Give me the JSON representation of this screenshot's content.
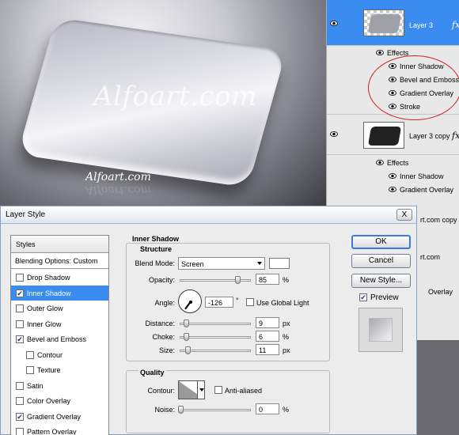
{
  "canvas": {
    "watermark": "Alfoart.com",
    "small_watermark": "Alfoart.com"
  },
  "layers_panel": {
    "layers": [
      {
        "name": "Layer 3",
        "selected": true,
        "fx_symbol": "fx",
        "effects_label": "Effects",
        "effects": [
          "Inner Shadow",
          "Bevel and Emboss",
          "Gradient Overlay",
          "Stroke"
        ]
      },
      {
        "name": "Layer 3 copy",
        "selected": false,
        "fx_symbol": "fx",
        "effects_label": "Effects",
        "effects": [
          "Inner Shadow",
          "Gradient Overlay"
        ]
      }
    ],
    "peek_texts": [
      "rt.com copy",
      "rt.com",
      "Overlay"
    ],
    "highlight_color": "#d02020"
  },
  "dialog": {
    "title": "Layer Style",
    "close_symbol": "X",
    "styles_header": "Styles",
    "blending_options": "Blending Options: Custom",
    "style_items": [
      {
        "label": "Drop Shadow",
        "checked": false,
        "active": false,
        "sub": false
      },
      {
        "label": "Inner Shadow",
        "checked": true,
        "active": true,
        "sub": false
      },
      {
        "label": "Outer Glow",
        "checked": false,
        "active": false,
        "sub": false
      },
      {
        "label": "Inner Glow",
        "checked": false,
        "active": false,
        "sub": false
      },
      {
        "label": "Bevel and Emboss",
        "checked": true,
        "active": false,
        "sub": false
      },
      {
        "label": "Contour",
        "checked": false,
        "active": false,
        "sub": true
      },
      {
        "label": "Texture",
        "checked": false,
        "active": false,
        "sub": true
      },
      {
        "label": "Satin",
        "checked": false,
        "active": false,
        "sub": false
      },
      {
        "label": "Color Overlay",
        "checked": false,
        "active": false,
        "sub": false
      },
      {
        "label": "Gradient Overlay",
        "checked": true,
        "active": false,
        "sub": false
      },
      {
        "label": "Pattern Overlay",
        "checked": false,
        "active": false,
        "sub": false
      }
    ],
    "section_title": "Inner Shadow",
    "structure": {
      "title": "Structure",
      "blend_mode_label": "Blend Mode:",
      "blend_mode_value": "Screen",
      "blend_color": "#ffffff",
      "opacity_label": "Opacity:",
      "opacity_value": "85",
      "opacity_unit": "%",
      "opacity_fraction": 0.85,
      "angle_label": "Angle:",
      "angle_value": "-126",
      "angle_unit": "°",
      "use_global_light_label": "Use Global Light",
      "use_global_light_checked": false,
      "distance_label": "Distance:",
      "distance_value": "9",
      "distance_unit": "px",
      "choke_label": "Choke:",
      "choke_value": "6",
      "choke_unit": "%",
      "size_label": "Size:",
      "size_value": "11",
      "size_unit": "px"
    },
    "quality": {
      "title": "Quality",
      "contour_label": "Contour:",
      "anti_aliased_label": "Anti-aliased",
      "anti_aliased_checked": false,
      "noise_label": "Noise:",
      "noise_value": "0",
      "noise_unit": "%"
    },
    "buttons": {
      "ok": "OK",
      "cancel": "Cancel",
      "new_style": "New Style...",
      "preview_label": "Preview",
      "preview_checked": true
    }
  }
}
